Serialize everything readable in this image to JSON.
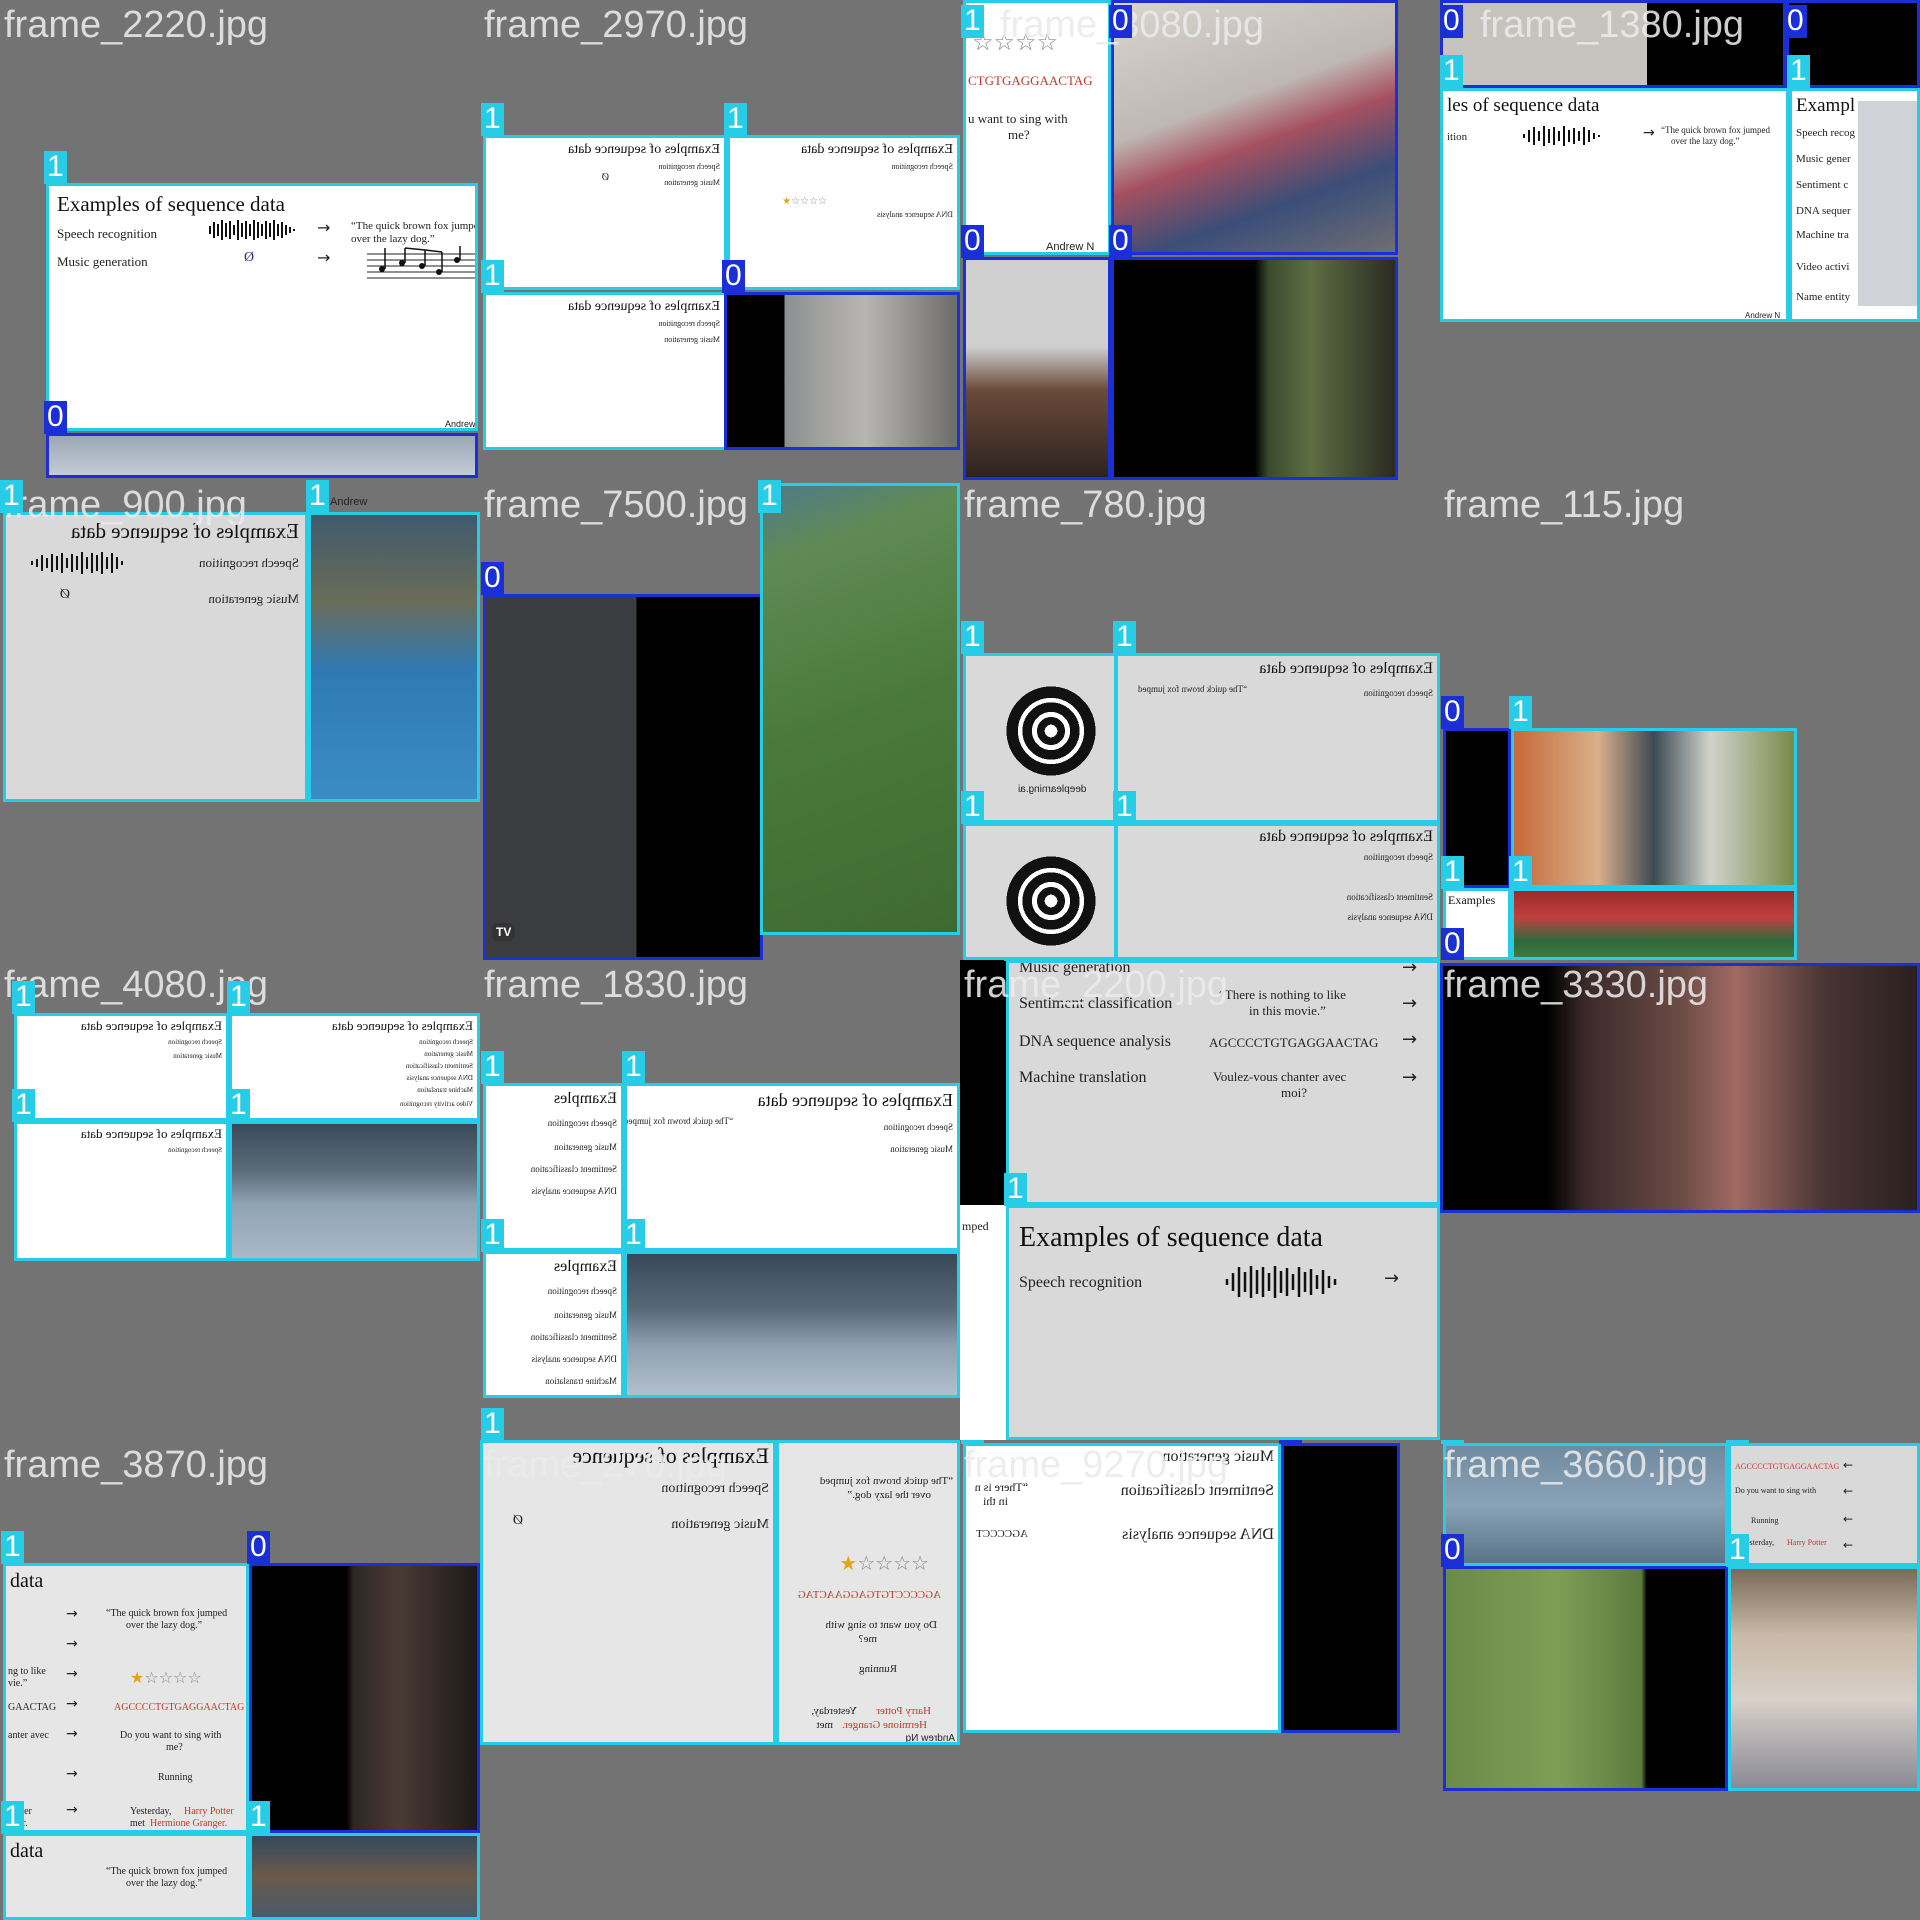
{
  "titles": {
    "c00": "frame_2220.jpg",
    "c01": "frame_2970.jpg",
    "c02": "frame_3080.jpg",
    "c03": "frame_1380.jpg",
    "c10": "frame_900.jpg",
    "c11": "frame_7500.jpg",
    "c12": "frame_780.jpg",
    "c13": "frame_115.jpg",
    "c20": "frame_4080.jpg",
    "c21": "frame_1830.jpg",
    "c22": "frame_2200.jpg",
    "c23": "frame_3330.jpg",
    "c30": "frame_3870.jpg",
    "c31": "frame_270.jpg",
    "c32": "frame_9270.jpg",
    "c33": "frame_3660.jpg"
  },
  "labels": {
    "one": "1",
    "zero": "0"
  },
  "slide": {
    "title": "Examples of sequence data",
    "title_partial_les": "les of sequence data",
    "title_partial_exampl": "Exampl",
    "title_partial_examples": "Examples",
    "title_partial_data": "data",
    "title_partial_e": "Examples of sequence",
    "speech": "Speech recognition",
    "music": "Music generation",
    "sentiment": "Sentiment classification",
    "dna": "DNA sequence analysis",
    "machine": "Machine translation",
    "video": "Video activity recognition",
    "name": "Name entity recognition",
    "fox_quote": "“The quick brown fox jumped over the lazy dog.”",
    "fox_l1": "“The quick brown fox jumped",
    "fox_l2": "over the lazy dog.”",
    "fox_cut": "“The quick brown fox jumpe",
    "nothing_l1": "“There is nothing to like",
    "nothing_l2": "in this movie.”",
    "nothing_cut_l1": "ng to like",
    "nothing_cut_l2": "vie.”",
    "dna_seq": "AGCCCCTGTGAGGAACTAG",
    "dna_seq_cut": "CTGTGAGGAACTAG",
    "dna_seq_cut2": "GAACTAG",
    "sing_l1": "Do you want to sing with",
    "sing_l2": "me?",
    "sing_cut_l1": "u want to sing with",
    "sing_cut_l2": "me?",
    "voulez_l1": "Voulez-vous chanter avec",
    "voulez_l2": "moi?",
    "voulez_cut": "anter avec",
    "running": "Running",
    "yesterday_l1": "Yesterday,",
    "harry": "Harry Potter",
    "met": "met",
    "hermione": "Hermione Granger.",
    "potter_cut": "Potter",
    "granger_cut": "nger.",
    "author": "Andrew Ng",
    "author_cut": "Andrew N",
    "author_cut2": "Andrew",
    "andrew_short": "Andrew",
    "mped": "mped",
    "ition": "ition",
    "speech_cut": "Speech recog",
    "music_cut": "Music gener",
    "sentiment_cut": "Sentiment c",
    "dna_cut": "DNA sequer",
    "machine_cut": "Machine tra",
    "video_cut": "Video activi",
    "name_cut": "Name entity",
    "there_cut_l1": "“There is n",
    "there_cut_l2": "in thi",
    "agcc_cut": "AGCCCCT",
    "music_note": "Ø",
    "deeplearning": "deeplearning.ai",
    "tv": "TV",
    "star_empty4": "☆☆☆☆",
    "star_full": "★",
    "arrow": "→",
    "arrow_l": "←"
  },
  "colors": {
    "class1": "#27cde6",
    "class0": "#1b2fd6",
    "background": "#737373"
  }
}
